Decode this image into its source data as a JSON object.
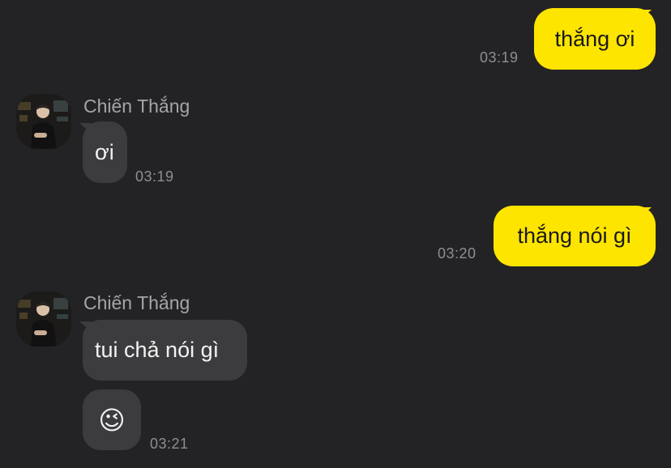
{
  "messages": [
    {
      "sender": "me",
      "text": "thắng ơi",
      "time": "03:19"
    },
    {
      "sender": "Chiến Thắng",
      "text": "ơi",
      "time": "03:19"
    },
    {
      "sender": "me",
      "text": "thắng nói gì",
      "time": "03:20"
    },
    {
      "sender": "Chiến Thắng",
      "text": "tui chả nói gì",
      "time": ""
    },
    {
      "sender": "Chiến Thắng",
      "text": "😉",
      "time": "03:21"
    }
  ],
  "contact": {
    "name": "Chiến Thắng"
  },
  "colors": {
    "background": "#232325",
    "my_bubble": "#fee500",
    "their_bubble": "#3c3c3f",
    "timestamp": "#8e8e93"
  }
}
